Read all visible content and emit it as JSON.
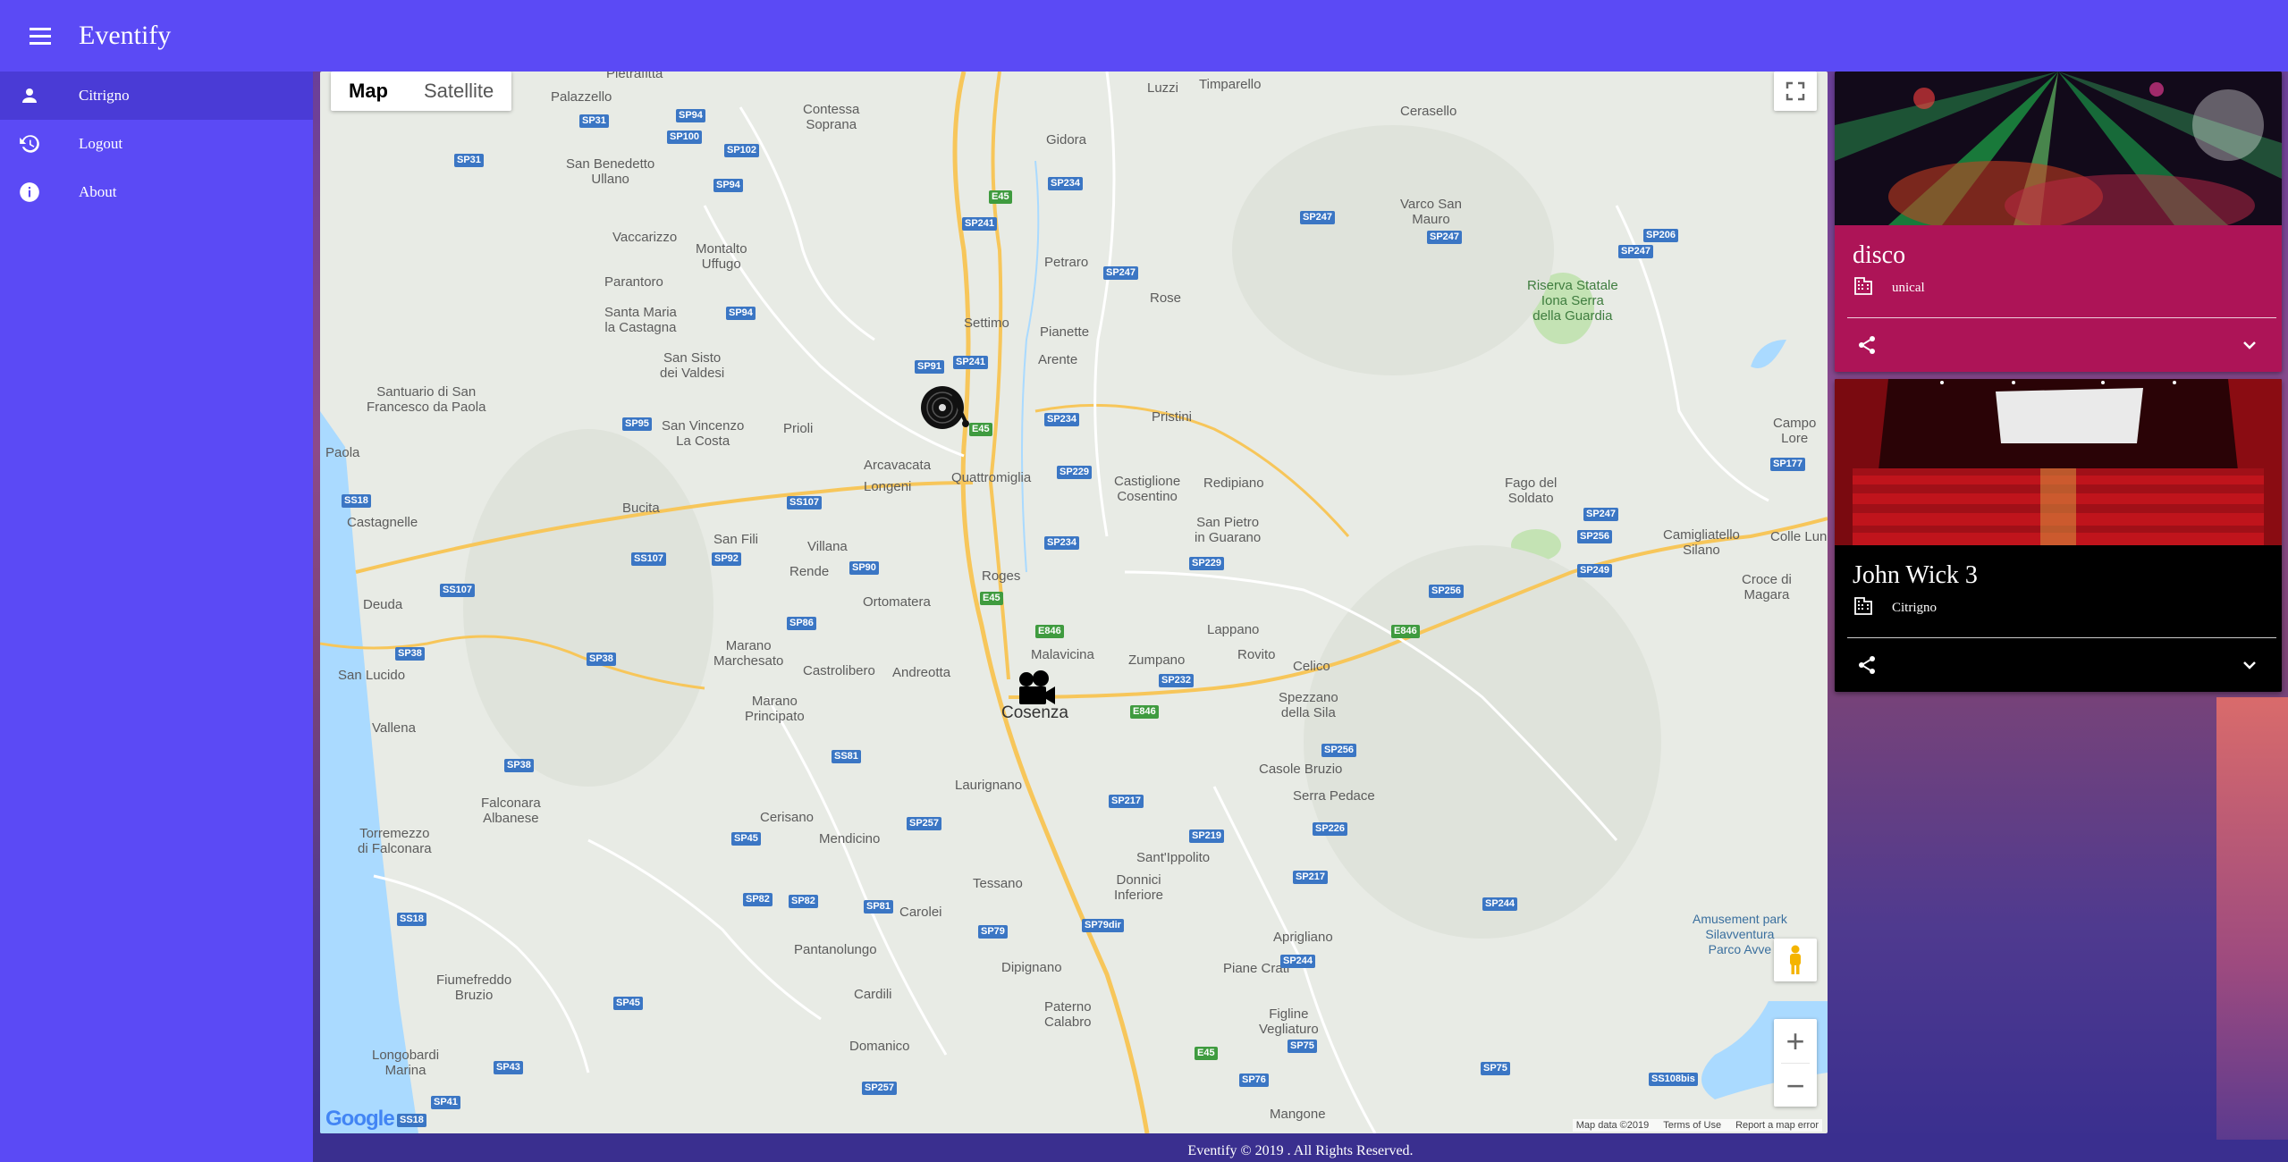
{
  "app": {
    "title": "Eventify"
  },
  "sidebar": {
    "items": [
      {
        "label": "Citrigno",
        "icon": "person-icon",
        "active": true
      },
      {
        "label": "Logout",
        "icon": "history-icon",
        "active": false
      },
      {
        "label": "About",
        "icon": "info-icon",
        "active": false
      }
    ]
  },
  "map": {
    "type_options": [
      "Map",
      "Satellite"
    ],
    "selected_type": "Map",
    "attribution": {
      "data": "Map data ©2019",
      "terms": "Terms of Use",
      "report": "Report a map error"
    },
    "logo_text": "Google",
    "places": {
      "pietrafitta": "Pietrafitta",
      "contessa": "Contessa\nSoprana",
      "luzzi": "Luzzi",
      "timparello": "Timparello",
      "cerasello": "Cerasello",
      "palazzello": "Palazzello",
      "gidora": "Gidora",
      "sanbenedetto": "San Benedetto\nUllano",
      "varco": "Varco San\nMauro",
      "vaccarizzo": "Vaccarizzo",
      "montalto": "Montalto\nUffugo",
      "petraro": "Petraro",
      "rose": "Rose",
      "parantoro": "Parantoro",
      "riserva": "Riserva Statale\nIona Serra\ndella Guardia",
      "santamaria": "Santa Maria\nla Castagna",
      "settimo": "Settimo",
      "pianette": "Pianette",
      "sansisto": "San Sisto\ndei Valdesi",
      "arente": "Arente",
      "santuario": "Santuario di San\nFrancesco da Paola",
      "sanvincenzo": "San Vincenzo\nLa Costa",
      "prioli": "Prioli",
      "pristini": "Pristini",
      "campo": "Campo\nLore",
      "paola": "Paola",
      "arcavacata": "Arcavacata",
      "longeni": "Longeni",
      "quattromiglia": "Quattromiglia",
      "castiglione": "Castiglione\nCosentino",
      "redipiano": "Redipiano",
      "fago": "Fago del\nSoldato",
      "castagnelle": "Castagnelle",
      "bucita": "Bucita",
      "sanfili": "San Fili",
      "sanpietro": "San Pietro\nin Guarano",
      "camigliatello": "Camigliatello\nSilano",
      "colle": "Colle Lung",
      "villana": "Villana",
      "rende": "Rende",
      "roges": "Roges",
      "croce": "Croce di\nMagara",
      "deuda": "Deuda",
      "ortomatera": "Ortomatera",
      "lappano": "Lappano",
      "marano": "Marano\nMarchesato",
      "castrolibero": "Castrolibero",
      "andreotta": "Andreotta",
      "malavicina": "Malavicina",
      "rovito": "Rovito",
      "sanlucido": "San Lucido",
      "celico": "Celico",
      "maranoprincipato": "Marano\nPrincipato",
      "zumpano": "Zumpano",
      "cosenza": "Cosenza",
      "spezzano": "Spezzano\ndella Sila",
      "vallena": "Vallena",
      "casole": "Casole Bruzio",
      "laurignano": "Laurignano",
      "serrapedace": "Serra Pedace",
      "falconara": "Falconara\nAlbanese",
      "cerisano": "Cerisano",
      "mendicino": "Mendicino",
      "torremezzo": "Torremezzo\ndi Falconara",
      "santippolito": "Sant'Ippolito",
      "donnici": "Donnici\nInferiore",
      "tessano": "Tessano",
      "carolei": "Carolei",
      "amusement": "Amusement park\nSilavventura\nParco Avve",
      "pantanolungo": "Pantanolungo",
      "dipignano": "Dipignano",
      "aprigliano": "Aprigliano",
      "fiumefreddo": "Fiumefreddo\nBruzio",
      "cardili": "Cardili",
      "pianecrati": "Piane Crati",
      "paterno": "Paterno\nCalabro",
      "figline": "Figline\nVegliaturo",
      "domanico": "Domanico",
      "longobardi": "Longobardi\nMarina",
      "mangone": "Mangone"
    },
    "roads": [
      "SP31",
      "SP94",
      "SP100",
      "SP102",
      "SP31",
      "SP94",
      "E45",
      "SP234",
      "SP241",
      "SP247",
      "SP247",
      "SP206",
      "SP247",
      "SP94",
      "SP247",
      "SP91",
      "SP241",
      "SP95",
      "E45",
      "SP234",
      "SP177",
      "SS18",
      "SP229",
      "SS107",
      "SS107",
      "SP92",
      "SP90",
      "SP234",
      "SP229",
      "SP256",
      "SP247",
      "SP256",
      "SP249",
      "SS107",
      "E45",
      "SP86",
      "E846",
      "SP38",
      "SP38",
      "SP232",
      "E846",
      "E846",
      "SP256",
      "SS81",
      "SP38",
      "SP257",
      "SP217",
      "SP219",
      "SP226",
      "SP45",
      "SP82",
      "SP82",
      "SP81",
      "SP217",
      "SP244",
      "SP79",
      "SP79dir",
      "SS18",
      "SP244",
      "SP45",
      "SP75",
      "SP43",
      "E45",
      "SP75",
      "SP76",
      "SP257",
      "SP41",
      "SS18",
      "SS108bis"
    ]
  },
  "events": [
    {
      "title": "disco",
      "location": "unical",
      "color": "#ad1457"
    },
    {
      "title": "John Wick 3",
      "location": "Citrigno",
      "color": "#000000"
    }
  ],
  "footer": {
    "text": "Eventify © 2019 . All Rights Reserved."
  }
}
